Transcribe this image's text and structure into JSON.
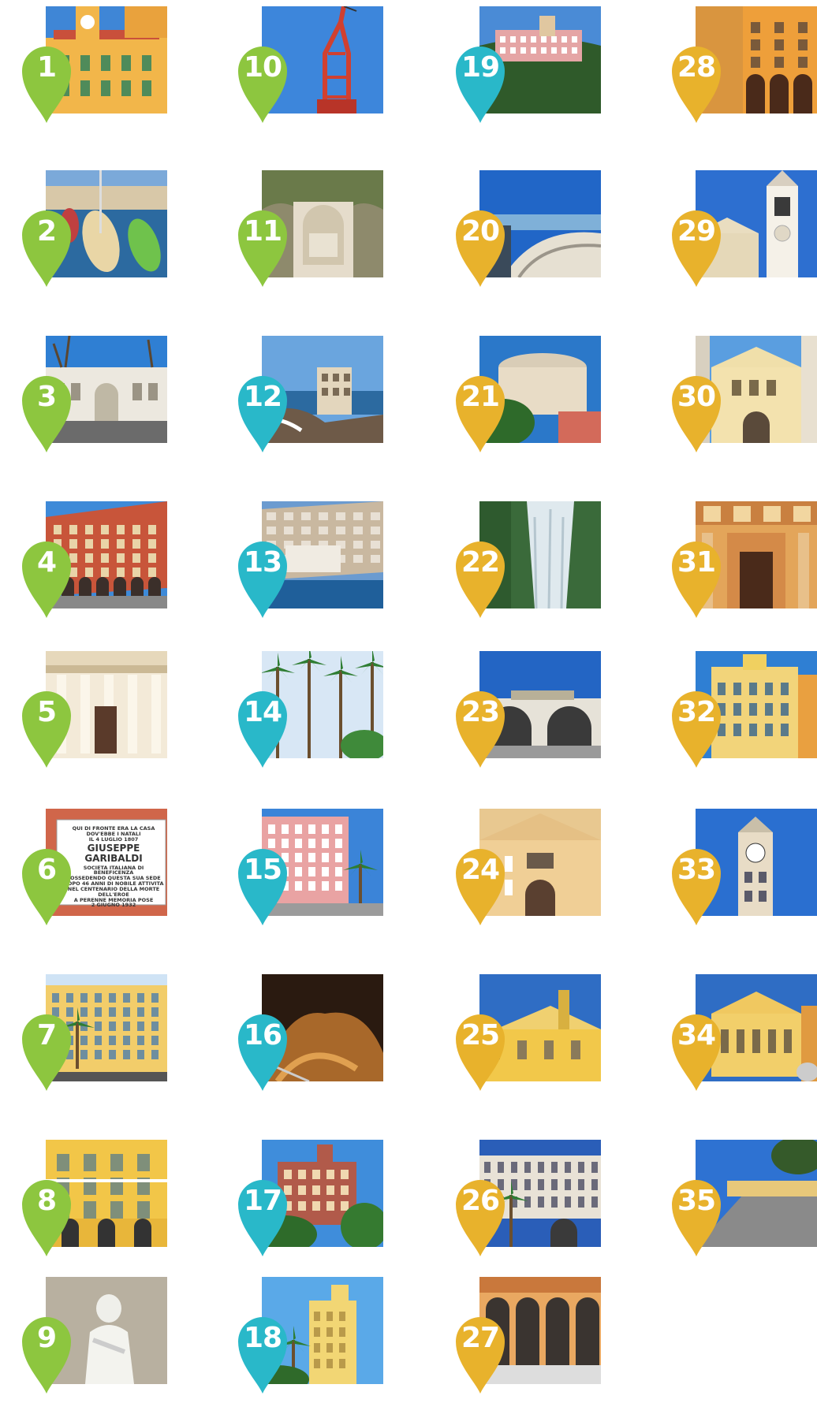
{
  "colors": {
    "green": "#8dc63f",
    "teal": "#29b8c9",
    "gold": "#e8b22c"
  },
  "stops": [
    {
      "number": "1",
      "color": "green",
      "scene": "clocktower"
    },
    {
      "number": "2",
      "color": "green",
      "scene": "harbor-boats"
    },
    {
      "number": "3",
      "color": "green",
      "scene": "gate-building"
    },
    {
      "number": "4",
      "color": "green",
      "scene": "red-arcade-building"
    },
    {
      "number": "5",
      "color": "green",
      "scene": "columned-portico"
    },
    {
      "number": "6",
      "color": "green",
      "scene": "garibaldi-plaque",
      "plaque_lines": [
        "QUI DI FRONTE ERA LA CASA",
        "DOV'EBBE I NATALI",
        "IL 4 LUGLIO 1807",
        "GIUSEPPE GARIBALDI",
        "SOCIETA ITALIANA DI BENEFICENZA",
        "POSSEDENDO QUESTA SUA SEDE",
        "DOPO 46 ANNI DI NOBILE ATTIVITA",
        "NEL CENTENARIO DELLA MORTE DELL'EROE",
        "A PERENNE MEMORIA POSE",
        "2 GIUGNO 1932"
      ]
    },
    {
      "number": "7",
      "color": "green",
      "scene": "yellow-building-palm"
    },
    {
      "number": "8",
      "color": "green",
      "scene": "yellow-facade"
    },
    {
      "number": "9",
      "color": "green",
      "scene": "statue"
    },
    {
      "number": "10",
      "color": "green",
      "scene": "red-crane"
    },
    {
      "number": "11",
      "color": "green",
      "scene": "war-memorial"
    },
    {
      "number": "12",
      "color": "teal",
      "scene": "coastal-villa"
    },
    {
      "number": "13",
      "color": "teal",
      "scene": "hillside-coast"
    },
    {
      "number": "14",
      "color": "teal",
      "scene": "palm-trees"
    },
    {
      "number": "15",
      "color": "teal",
      "scene": "pink-hotel"
    },
    {
      "number": "16",
      "color": "teal",
      "scene": "grotto"
    },
    {
      "number": "17",
      "color": "teal",
      "scene": "hill-villa"
    },
    {
      "number": "18",
      "color": "teal",
      "scene": "castle-villa"
    },
    {
      "number": "19",
      "color": "teal",
      "scene": "hilltop-chateau"
    },
    {
      "number": "20",
      "color": "gold",
      "scene": "sea-promenade"
    },
    {
      "number": "21",
      "color": "gold",
      "scene": "round-tower"
    },
    {
      "number": "22",
      "color": "gold",
      "scene": "waterfall"
    },
    {
      "number": "23",
      "color": "gold",
      "scene": "arches-terrace"
    },
    {
      "number": "24",
      "color": "gold",
      "scene": "church-facade"
    },
    {
      "number": "25",
      "color": "gold",
      "scene": "yellow-chapel"
    },
    {
      "number": "26",
      "color": "gold",
      "scene": "palace-gate"
    },
    {
      "number": "27",
      "color": "gold",
      "scene": "arcade-cloister"
    },
    {
      "number": "28",
      "color": "gold",
      "scene": "orange-corner-building"
    },
    {
      "number": "29",
      "color": "gold",
      "scene": "bell-tower"
    },
    {
      "number": "30",
      "color": "gold",
      "scene": "baroque-church"
    },
    {
      "number": "31",
      "color": "gold",
      "scene": "ornate-doorway"
    },
    {
      "number": "32",
      "color": "gold",
      "scene": "yellow-palace"
    },
    {
      "number": "33",
      "color": "gold",
      "scene": "clock-tower"
    },
    {
      "number": "34",
      "color": "gold",
      "scene": "cathedral-square"
    },
    {
      "number": "35",
      "color": "gold",
      "scene": "open-square"
    }
  ]
}
